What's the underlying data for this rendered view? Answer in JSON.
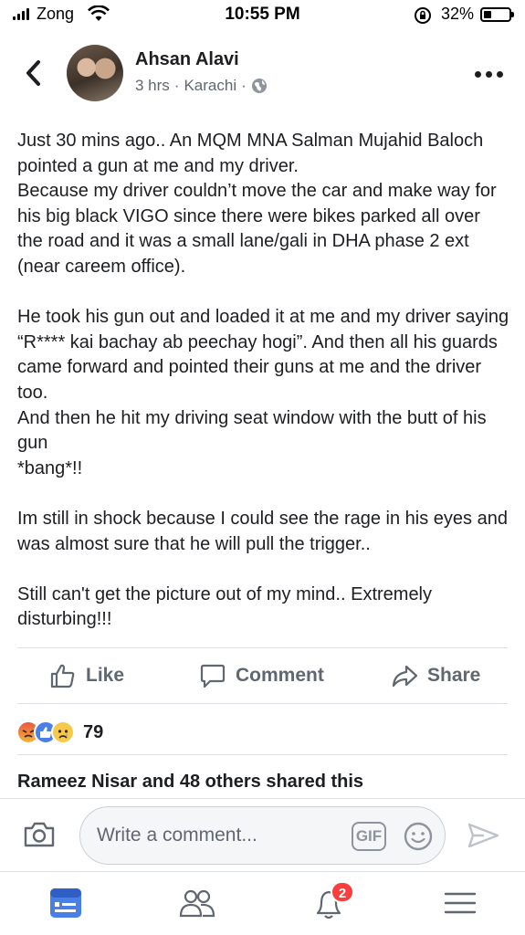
{
  "status_bar": {
    "carrier": "Zong",
    "time": "10:55 PM",
    "battery": "32%",
    "battery_level": 0.32
  },
  "post": {
    "author": "Ahsan Alavi",
    "time_ago": "3 hrs",
    "separator": "·",
    "location": "Karachi",
    "privacy_icon": "globe-icon",
    "paragraphs": [
      "Just 30 mins ago.. An MQM MNA Salman Mujahid Baloch pointed a gun at me and my driver.\nBecause my driver couldn’t move the car and make way for his big  black VIGO since there were bikes parked all over the road and it was a small lane/gali in DHA phase 2 ext (near careem office).",
      "He took his gun out and loaded it at me and my driver saying “R**** kai bachay ab peechay hogi”. And then all his guards came forward and pointed their guns at me and the driver too.\nAnd then he hit my driving seat window with the butt of his gun\n *bang*!!",
      "Im still in shock because I could see the rage in his eyes and was almost sure that he will pull the trigger..",
      "Still can't get the picture out of my mind.. Extremely disturbing!!!"
    ]
  },
  "actions": {
    "like": "Like",
    "comment": "Comment",
    "share": "Share"
  },
  "reactions": {
    "types": [
      "angry",
      "like",
      "sad"
    ],
    "count": "79"
  },
  "shares": {
    "text": "Rameez Nisar and 48 others shared this"
  },
  "comment_bar": {
    "placeholder": "Write a comment...",
    "gif_label": "GIF"
  },
  "tab_bar": {
    "items": [
      "news-feed",
      "friends",
      "notifications",
      "menu"
    ],
    "notification_badge": "2"
  },
  "colors": {
    "accent": "#4267b2",
    "text": "#1c1e21",
    "muted": "#606770",
    "badge": "#fa3e3e"
  }
}
